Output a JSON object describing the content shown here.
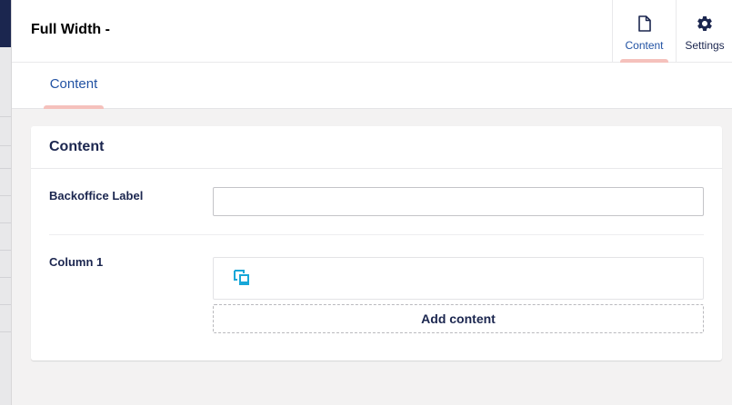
{
  "header": {
    "title": "Full Width -",
    "apps": [
      {
        "label": "Content",
        "icon": "document-icon",
        "active": true
      },
      {
        "label": "Settings",
        "icon": "gear-icon",
        "active": false
      }
    ]
  },
  "tabs": [
    {
      "label": "Content",
      "active": true
    }
  ],
  "card": {
    "title": "Content",
    "fields": {
      "backoffice_label": {
        "label": "Backoffice Label",
        "value": "",
        "placeholder": ""
      },
      "column_1": {
        "label": "Column 1",
        "icon": "layout-blocks-icon",
        "add_button_label": "Add content"
      }
    }
  },
  "colors": {
    "accent": "#2152a3",
    "indicator": "#f5c1bc",
    "icon_cyan": "#17a7d8",
    "text_dark": "#1b264f",
    "nav_dark": "#1b264f"
  }
}
